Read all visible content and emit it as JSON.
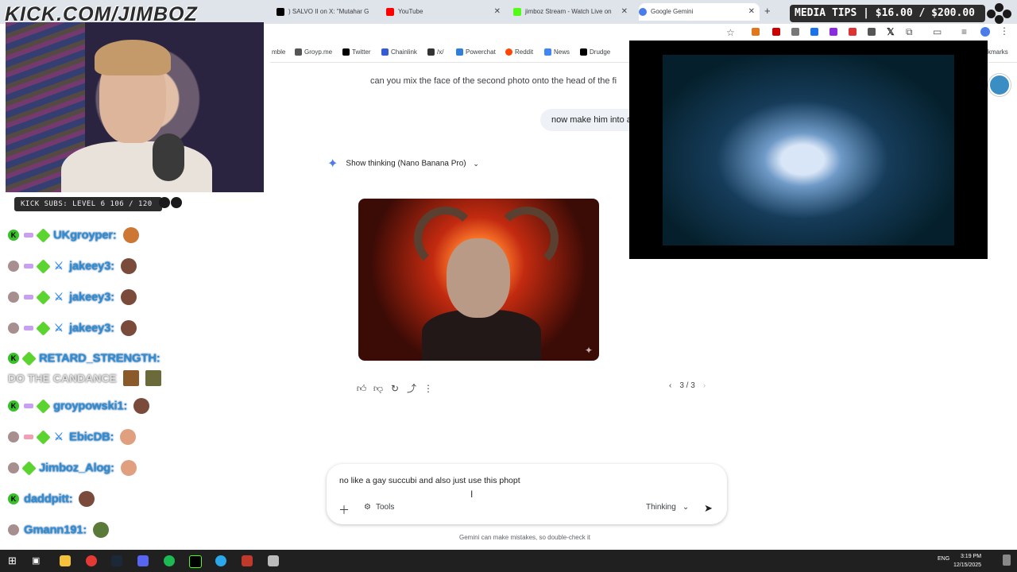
{
  "tabs": [
    {
      "title": ") SALVO II on X: \"Mutahar G",
      "favicon_color": "#000000"
    },
    {
      "title": "YouTube",
      "favicon_color": "#ff0000"
    },
    {
      "title": "jimboz Stream - Watch Live on",
      "favicon_color": "#53fc18"
    },
    {
      "title": "Google Gemini",
      "favicon_color": "#4a7dea",
      "active": true
    }
  ],
  "new_tab_label": "+",
  "bookmarks": [
    {
      "label": "mble",
      "color": "#888888"
    },
    {
      "label": "Groyp.me",
      "color": "#555555"
    },
    {
      "label": "Twitter",
      "color": "#000000"
    },
    {
      "label": "Chainlink",
      "color": "#375bd2"
    },
    {
      "label": "/x/",
      "color": "#333333"
    },
    {
      "label": "Powerchat",
      "color": "#2f7fd8"
    },
    {
      "label": "Reddit",
      "color": "#ff4500"
    },
    {
      "label": "News",
      "color": "#4285f4"
    },
    {
      "label": "Drudge",
      "color": "#000000"
    },
    {
      "label": "kmarks",
      "color": "#888888"
    }
  ],
  "overlay": {
    "stream_url": "KICK.COM/JIMBOZ",
    "kick_subs": "KICK SUBS: LEVEL 6 106 / 120",
    "media_tips": "MEDIA TIPS | $16.00 / $200.00"
  },
  "chat": [
    {
      "badges": [
        "k",
        "sub",
        "gem"
      ],
      "user": "UKgroyper:",
      "text": ""
    },
    {
      "badges": [
        "ava",
        "sub",
        "gem",
        "sword"
      ],
      "user": "jakeey3:",
      "text": ""
    },
    {
      "badges": [
        "ava",
        "sub",
        "gem",
        "sword"
      ],
      "user": "jakeey3:",
      "text": ""
    },
    {
      "badges": [
        "ava",
        "sub",
        "gem",
        "sword"
      ],
      "user": "jakeey3:",
      "text": ""
    },
    {
      "badges": [
        "k",
        "gem"
      ],
      "user": "RETARD_STRENGTH:",
      "text": "DO THE CANDANCE"
    },
    {
      "badges": [
        "k",
        "sub",
        "gem"
      ],
      "user": "groypowski1:",
      "text": ""
    },
    {
      "badges": [
        "ava",
        "sub",
        "gem",
        "sword"
      ],
      "user": "EbicDB:",
      "text": ""
    },
    {
      "badges": [
        "ava",
        "gem"
      ],
      "user": "Jimboz_Alog:",
      "text": ""
    },
    {
      "badges": [
        "k"
      ],
      "user": "daddpitt:",
      "text": ""
    },
    {
      "badges": [
        "ava"
      ],
      "user": "Gmann191:",
      "text": ""
    }
  ],
  "gemini": {
    "user_message_1": "can you mix the face of the second photo onto the head of the fi",
    "user_message_2": "now make him into a",
    "thinking_label": "Show thinking (Nano Banana Pro)",
    "pager": "3 / 3",
    "prompt_value": "no like a gay succubi and also just use this phopt",
    "tools_label": "Tools",
    "mode_label": "Thinking",
    "disclaimer": "Gemini can make mistakes, so double-check it"
  },
  "taskbar": {
    "lang": "ENG",
    "time": "3:19 PM",
    "date": "12/15/2025"
  }
}
